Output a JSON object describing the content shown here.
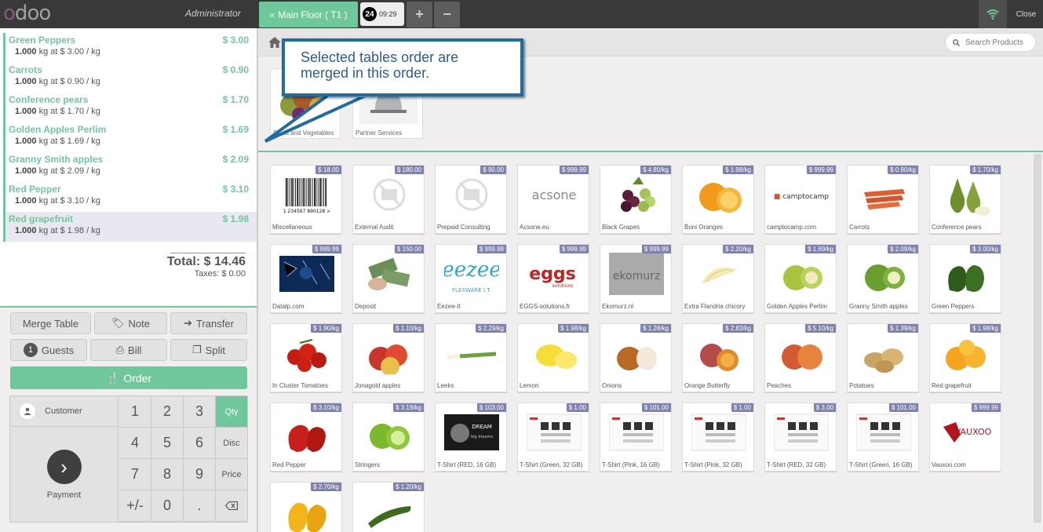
{
  "header": {
    "username": "Administrator",
    "floor_label": "Main Floor ( T1 )",
    "order_number": "24",
    "order_time": "09:29",
    "add_label": "+",
    "remove_label": "−",
    "close_label": "Close"
  },
  "order_lines": [
    {
      "name": "Green Peppers",
      "price": "$ 3.00",
      "qty": "1.000",
      "detail": "kg at $ 3.00 / kg"
    },
    {
      "name": "Carrots",
      "price": "$ 0.90",
      "qty": "1.000",
      "detail": "kg at $ 0.90 / kg"
    },
    {
      "name": "Conference pears",
      "price": "$ 1.70",
      "qty": "1.000",
      "detail": "kg at $ 1.70 / kg"
    },
    {
      "name": "Golden Apples Perlim",
      "price": "$ 1.69",
      "qty": "1.000",
      "detail": "kg at $ 1.69 / kg"
    },
    {
      "name": "Granny Smith apples",
      "price": "$ 2.09",
      "qty": "1.000",
      "detail": "kg at $ 2.09 / kg"
    },
    {
      "name": "Red Pepper",
      "price": "$ 3.10",
      "qty": "1.000",
      "detail": "kg at $ 3.10 / kg"
    },
    {
      "name": "Red grapefruit",
      "price": "$ 1.98",
      "qty": "1.000",
      "detail": "kg at $ 1.98 / kg"
    }
  ],
  "totals": {
    "total": "Total: $ 14.46",
    "taxes": "Taxes: $ 0.00"
  },
  "actions": {
    "merge_table": "Merge Table",
    "note": "Note",
    "transfer": "Transfer",
    "guests_count": "1",
    "guests": "Guests",
    "bill": "Bill",
    "split": "Split",
    "order": "Order"
  },
  "numpad": {
    "customer": "Customer",
    "payment": "Payment",
    "keys": [
      "1",
      "2",
      "3",
      "4",
      "5",
      "6",
      "7",
      "8",
      "9",
      "+/-",
      "0",
      "."
    ],
    "qty": "Qty",
    "disc": "Disc",
    "price": "Price"
  },
  "search": {
    "placeholder": "Search Products"
  },
  "categories": [
    {
      "label": "Fruits and Vegetables"
    },
    {
      "label": "Partner Services"
    }
  ],
  "callout": {
    "text": "Selected tables order are merged in this order."
  },
  "products": [
    {
      "name": "Miscellaneous",
      "price": "$ 18.00"
    },
    {
      "name": "External Audit",
      "price": "$ 180.00"
    },
    {
      "name": "Prepaid Consulting",
      "price": "$ 90.00"
    },
    {
      "name": "Acsone.eu",
      "price": "$ 999.99"
    },
    {
      "name": "Black Grapes",
      "price": "$ 4.80/kg"
    },
    {
      "name": "Boni Oranges",
      "price": "$ 1.98/kg"
    },
    {
      "name": "camptocamp.com",
      "price": "$ 999.99"
    },
    {
      "name": "Carrots",
      "price": "$ 0.90/kg"
    },
    {
      "name": "Conference pears",
      "price": "$ 1.70/kg"
    },
    {
      "name": "Datalp.com",
      "price": "$ 999.99"
    },
    {
      "name": "Deposit",
      "price": "$ 150.00"
    },
    {
      "name": "Eezee-It",
      "price": "$ 999.99"
    },
    {
      "name": "EGGS-solutions.fr",
      "price": "$ 999.99"
    },
    {
      "name": "Ekomurz.nl",
      "price": "$ 999.99"
    },
    {
      "name": "Extra Flandria chicory",
      "price": "$ 2.20/kg"
    },
    {
      "name": "Golden Apples Perlim",
      "price": "$ 1.69/kg"
    },
    {
      "name": "Granny Smith apples",
      "price": "$ 2.09/kg"
    },
    {
      "name": "Green Peppers",
      "price": "$ 3.00/kg"
    },
    {
      "name": "In Cluster Tomatoes",
      "price": "$ 1.90/kg"
    },
    {
      "name": "Jonagold apples",
      "price": "$ 1.10/kg"
    },
    {
      "name": "Leeks",
      "price": "$ 2.29/kg"
    },
    {
      "name": "Lemon",
      "price": "$ 1.98/kg"
    },
    {
      "name": "Onions",
      "price": "$ 1.28/kg"
    },
    {
      "name": "Orange Butterfly",
      "price": "$ 2.83/kg"
    },
    {
      "name": "Peaches",
      "price": "$ 5.10/kg"
    },
    {
      "name": "Potatoes",
      "price": "$ 1.39/kg"
    },
    {
      "name": "Red grapefruit",
      "price": "$ 1.98/kg"
    },
    {
      "name": "Red Pepper",
      "price": "$ 3.10/kg"
    },
    {
      "name": "Stringers",
      "price": "$ 3.19/kg"
    },
    {
      "name": "T-Shirt (RED, 16 GB)",
      "price": "$ 103.00"
    },
    {
      "name": "T-Shirt (Green, 32 GB)",
      "price": "$ 1.00"
    },
    {
      "name": "T-Shirt (Pink, 16 GB)",
      "price": "$ 101.00"
    },
    {
      "name": "T-Shirt (Pink, 32 GB)",
      "price": "$ 1.00"
    },
    {
      "name": "T-Shirt (RED, 32 GB)",
      "price": "$ 3.00"
    },
    {
      "name": "T-Shirt (Green, 16 GB)",
      "price": "$ 101.00"
    },
    {
      "name": "Vauxoo.com",
      "price": "$ 999.99"
    },
    {
      "name": "",
      "price": "$ 2.70/kg"
    },
    {
      "name": "",
      "price": "$ 1.20/kg"
    }
  ],
  "colors": {
    "accent": "#6ec89b",
    "price_badge": "#7f82ac",
    "topbar": "#393939"
  }
}
